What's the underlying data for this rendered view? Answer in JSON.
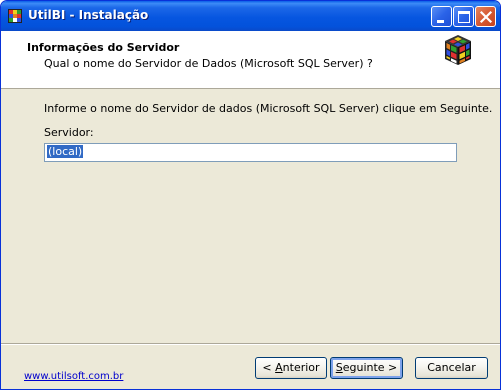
{
  "window": {
    "title": "UtilBI - Instalação",
    "icon": "app-cube-icon"
  },
  "titlebar_buttons": {
    "minimize_icon": "minimize-icon",
    "maximize_icon": "maximize-icon",
    "close_icon": "close-icon"
  },
  "header": {
    "title": "Informações do Servidor",
    "subtitle": "Qual o nome do Servidor de Dados (Microsoft SQL Server) ?",
    "logo": "rubik-cube-logo"
  },
  "body": {
    "instruction": "Informe o nome do Servidor de dados (Microsoft SQL Server) clique em Seguinte.",
    "server_label": "Servidor:",
    "server_value": "(local)"
  },
  "footer": {
    "link": "www.utilsoft.com.br",
    "back_prefix": "< ",
    "back_accel": "A",
    "back_rest": "nterior",
    "next_accel": "S",
    "next_rest": "eguinte >",
    "cancel": "Cancelar"
  },
  "colors": {
    "titlebar": "#0054E3",
    "dialog_bg": "#ECE9D8",
    "selection": "#316AC5",
    "link": "#0000CC"
  }
}
